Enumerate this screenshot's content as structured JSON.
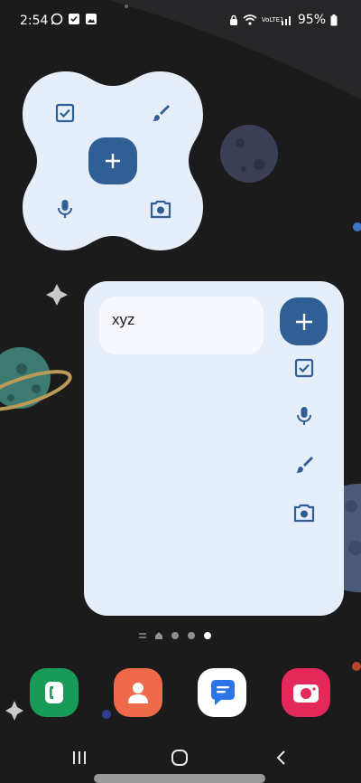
{
  "status_bar": {
    "time": "2:54",
    "network_label": "VoLTE1",
    "battery_percent": "95%"
  },
  "quick_widget": {
    "buttons": [
      "checklist-icon",
      "brush-icon",
      "add-icon",
      "mic-icon",
      "camera-icon"
    ]
  },
  "notes_widget": {
    "note_text": "xyz",
    "tools": [
      "add-icon",
      "checklist-icon",
      "mic-icon",
      "brush-icon",
      "camera-icon"
    ]
  },
  "page_indicator": {
    "pages": 5,
    "active_index": 4
  },
  "dock": {
    "apps": [
      "phone-icon",
      "contacts-icon",
      "messages-icon",
      "camera-app-icon"
    ]
  },
  "navigation": {
    "buttons": [
      "recents-icon",
      "home-icon",
      "back-icon"
    ]
  },
  "colors": {
    "accent": "#2f5f94",
    "widget_bg": "#e6eefa",
    "wallpaper": "#1b1b1c"
  }
}
